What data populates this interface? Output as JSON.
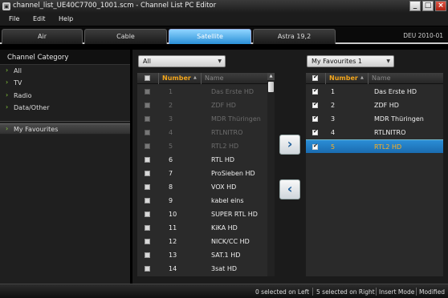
{
  "window": {
    "title": "channel_list_UE40C7700_1001.scm - Channel List PC Editor",
    "app_icon": "tv-icon",
    "controls": [
      "minimize-icon",
      "maximize-icon",
      "close-icon"
    ]
  },
  "menu": {
    "file": "File",
    "edit": "Edit",
    "help": "Help"
  },
  "tabs": [
    {
      "label": "Air"
    },
    {
      "label": "Cable"
    },
    {
      "label": "Satellite"
    },
    {
      "label": "Astra 19,2"
    }
  ],
  "active_tab": "Satellite",
  "region_info": "DEU  2010-01",
  "categories": {
    "header": "Channel Category",
    "items": [
      {
        "label": "All"
      },
      {
        "label": "TV"
      },
      {
        "label": "Radio"
      },
      {
        "label": "Data/Other"
      },
      {
        "label": "My Favourites"
      }
    ],
    "selected": "My Favourites"
  },
  "left_list": {
    "dropdown": "All",
    "col_number": "Number",
    "col_name": "Name",
    "rows": [
      {
        "num": "1",
        "name": "Das Erste HD",
        "dim": true
      },
      {
        "num": "2",
        "name": "ZDF HD",
        "dim": true
      },
      {
        "num": "3",
        "name": "MDR Thüringen",
        "dim": true
      },
      {
        "num": "4",
        "name": "RTLNITRO",
        "dim": true
      },
      {
        "num": "5",
        "name": "RTL2 HD",
        "dim": true
      },
      {
        "num": "6",
        "name": "RTL HD",
        "dim": false
      },
      {
        "num": "7",
        "name": "ProSieben HD",
        "dim": false
      },
      {
        "num": "8",
        "name": "VOX HD",
        "dim": false
      },
      {
        "num": "9",
        "name": "kabel eins",
        "dim": false
      },
      {
        "num": "10",
        "name": "SUPER RTL HD",
        "dim": false
      },
      {
        "num": "11",
        "name": "KiKA HD",
        "dim": false
      },
      {
        "num": "12",
        "name": "NICK/CC HD",
        "dim": false
      },
      {
        "num": "13",
        "name": "SAT.1 HD",
        "dim": false
      },
      {
        "num": "14",
        "name": "3sat HD",
        "dim": false
      }
    ]
  },
  "right_list": {
    "dropdown": "My Favourites 1",
    "col_number": "Number",
    "col_name": "Name",
    "rows": [
      {
        "num": "1",
        "name": "Das Erste HD",
        "checked": true,
        "selected": false
      },
      {
        "num": "2",
        "name": "ZDF HD",
        "checked": true,
        "selected": false
      },
      {
        "num": "3",
        "name": "MDR Thüringen",
        "checked": true,
        "selected": false
      },
      {
        "num": "4",
        "name": "RTLNITRO",
        "checked": true,
        "selected": false
      },
      {
        "num": "5",
        "name": "RTL2 HD",
        "checked": true,
        "selected": true
      }
    ]
  },
  "buttons": {
    "add": "›",
    "remove": "‹"
  },
  "status": {
    "left": "0 selected on Left",
    "right": "5 selected on Right",
    "mode": "Insert Mode",
    "state": "Modified"
  },
  "colors": {
    "accent": "#2a8fd6",
    "header_number": "#f2a51c",
    "category_chevron": "#8ad13a"
  }
}
